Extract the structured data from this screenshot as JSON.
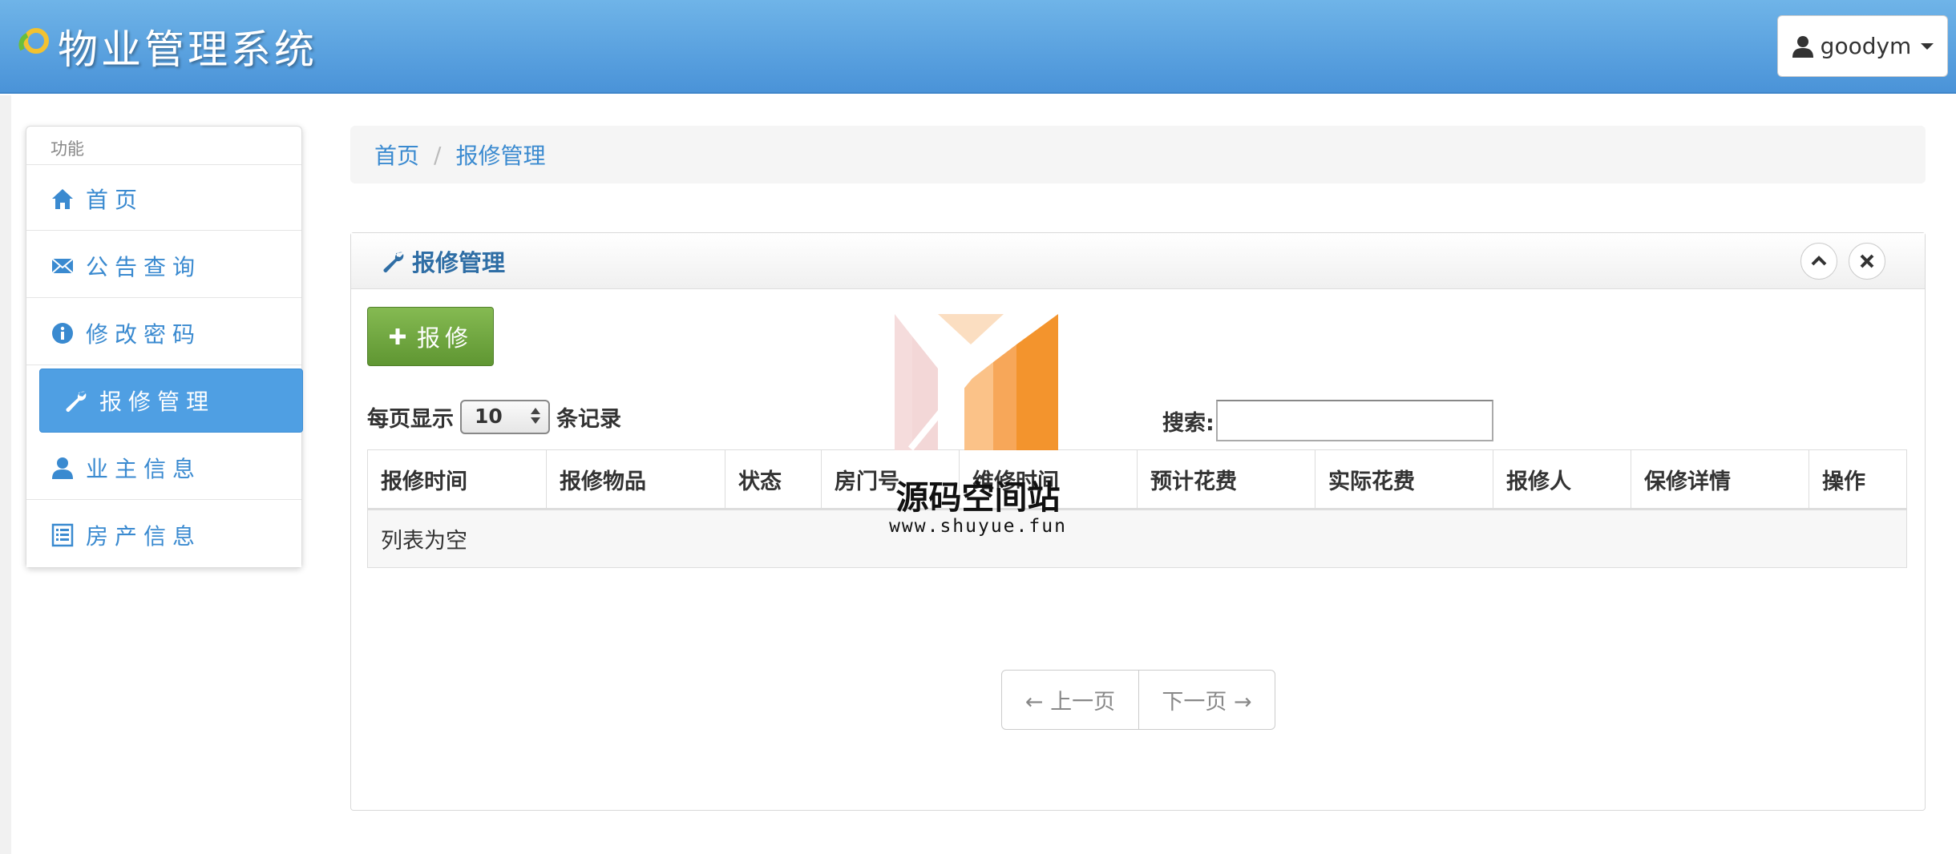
{
  "header": {
    "title": "物业管理系统",
    "user_name": "goodym"
  },
  "sidebar": {
    "heading": "功能",
    "items": [
      {
        "label": "首页",
        "icon": "home-icon"
      },
      {
        "label": "公告查询",
        "icon": "envelope-icon"
      },
      {
        "label": "修改密码",
        "icon": "info-icon"
      },
      {
        "label": "报修管理",
        "icon": "wrench-icon",
        "active": true
      },
      {
        "label": "业主信息",
        "icon": "user-icon"
      },
      {
        "label": "房产信息",
        "icon": "list-icon"
      }
    ]
  },
  "breadcrumb": {
    "home": "首页",
    "separator": "/",
    "current": "报修管理"
  },
  "panel": {
    "title": "报修管理",
    "add_label": "报修",
    "length_prefix": "每页显示",
    "length_value": "10",
    "length_suffix": "条记录",
    "search_label": "搜索:",
    "columns": [
      "报修时间",
      "报修物品",
      "状态",
      "房门号",
      "维修时间",
      "预计花费",
      "实际花费",
      "报修人",
      "保修详情",
      "操作"
    ],
    "empty_text": "列表为空",
    "prev_label": "← 上一页",
    "next_label": "下一页 →"
  },
  "watermark": {
    "title": "源码空间站",
    "url": "www.shuyue.fun"
  },
  "colors": {
    "header": "#4a93d8",
    "accent": "#3a8ad0",
    "active": "#4f9fe3",
    "add_button": "#6ea540"
  }
}
